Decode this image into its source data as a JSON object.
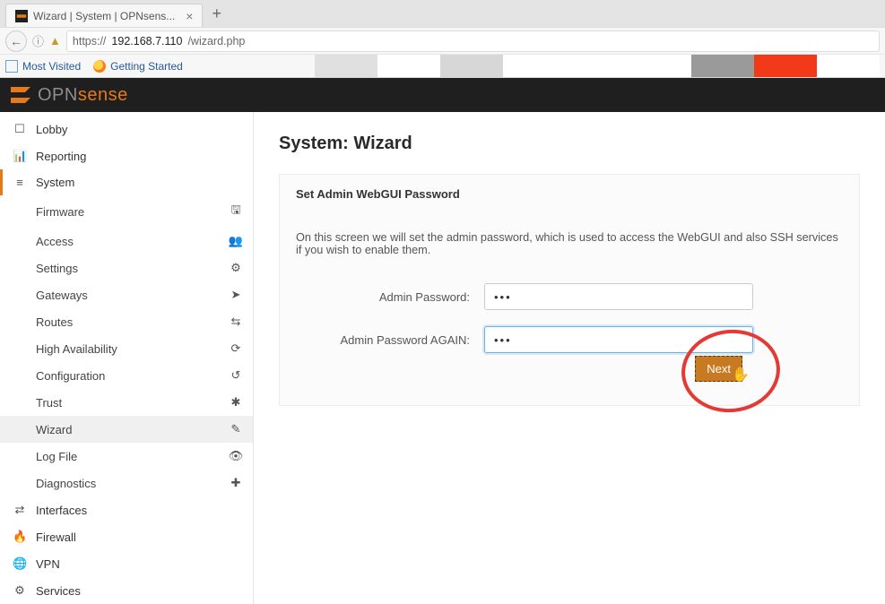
{
  "browser": {
    "tab_title": "Wizard | System | OPNsens...",
    "url_prefix": "https://",
    "url_host": "192.168.7.110",
    "url_path": "/wizard.php",
    "bookmarks": {
      "most_visited": "Most Visited",
      "getting_started": "Getting Started"
    }
  },
  "brand": {
    "text_main": "OPN",
    "text_accent": "sense"
  },
  "sidebar": {
    "lobby": "Lobby",
    "reporting": "Reporting",
    "system": "System",
    "system_items": {
      "firmware": "Firmware",
      "access": "Access",
      "settings": "Settings",
      "gateways": "Gateways",
      "routes": "Routes",
      "high_availability": "High Availability",
      "configuration": "Configuration",
      "trust": "Trust",
      "wizard": "Wizard",
      "log_file": "Log File",
      "diagnostics": "Diagnostics"
    },
    "interfaces": "Interfaces",
    "firewall": "Firewall",
    "vpn": "VPN",
    "services": "Services"
  },
  "page": {
    "title": "System: Wizard",
    "section_title": "Set Admin WebGUI Password",
    "description": "On this screen we will set the admin password, which is used to access the WebGUI and also SSH services if you wish to enable them.",
    "labels": {
      "admin_password": "Admin Password:",
      "admin_password_again": "Admin Password AGAIN:"
    },
    "values": {
      "pw1": "•••",
      "pw2": "•••"
    },
    "next": "Next"
  }
}
